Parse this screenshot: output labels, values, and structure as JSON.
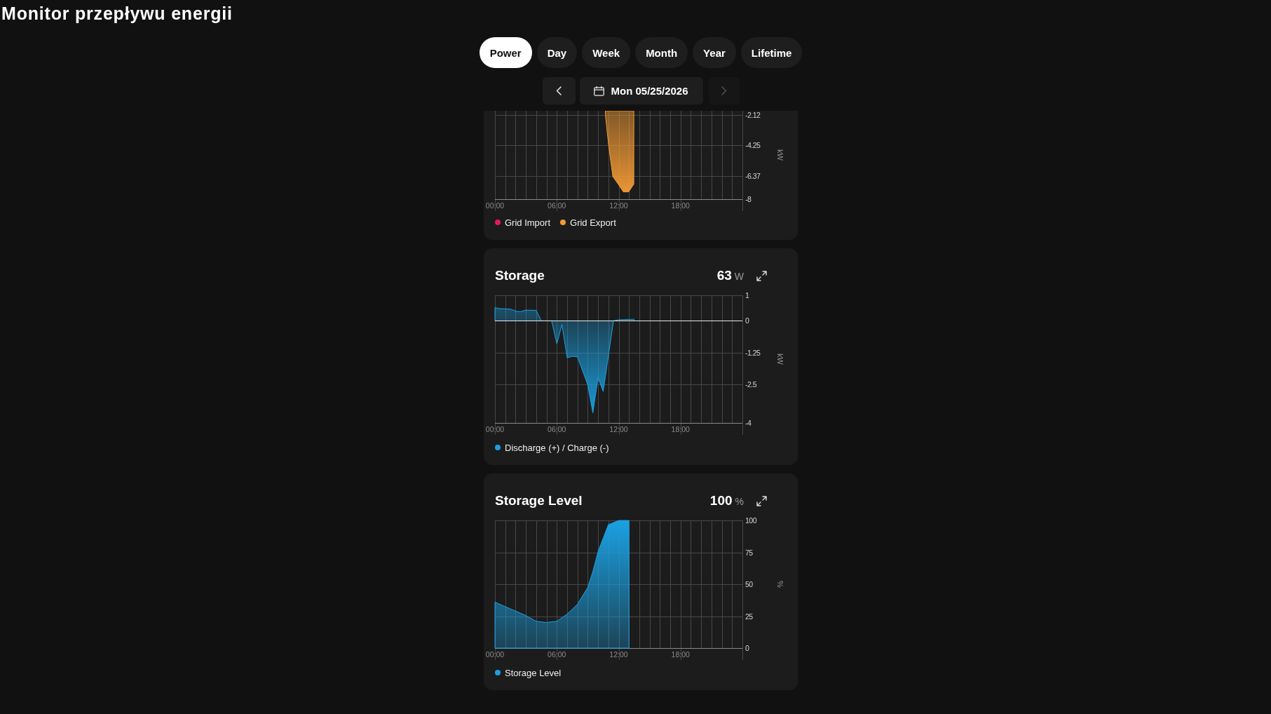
{
  "title": "Monitor przepływu energii",
  "tabs": [
    {
      "label": "Power",
      "selected": true
    },
    {
      "label": "Day",
      "selected": false
    },
    {
      "label": "Week",
      "selected": false
    },
    {
      "label": "Month",
      "selected": false
    },
    {
      "label": "Year",
      "selected": false
    },
    {
      "label": "Lifetime",
      "selected": false
    }
  ],
  "date_nav": {
    "date": "Mon 05/25/2026",
    "prev_disabled": false,
    "next_disabled": true
  },
  "cards": [
    {
      "chart_data": {
        "type": "area",
        "grid": true,
        "ylabel": "kW",
        "xlim": [
          0,
          24
        ],
        "ylim": [
          -8,
          -1.85
        ],
        "xticks": [
          {
            "value": 0,
            "label": "00:00"
          },
          {
            "value": 6,
            "label": "06:00"
          },
          {
            "value": 12,
            "label": "12:00"
          },
          {
            "value": 18,
            "label": "18:00"
          }
        ],
        "yticks": [
          -2.12,
          -4.25,
          -6.37,
          -8
        ],
        "x": [
          10.71,
          11.04,
          11.43,
          11.95,
          12.45,
          12.97,
          13.47
        ],
        "series": [
          {
            "name": "Grid Import",
            "color": "#e8175d",
            "values": [
              null,
              null,
              null,
              null,
              null,
              null,
              null
            ]
          },
          {
            "name": "Grid Export",
            "color": "#f29a35",
            "values": [
              -2.12,
              -4.34,
              -6.42,
              -6.95,
              -7.49,
              -7.49,
              -6.95
            ]
          }
        ]
      }
    },
    {
      "title": "Storage",
      "value": "63",
      "unit": "W",
      "chart_data": {
        "type": "area",
        "grid": true,
        "ylabel": "kW",
        "xlim": [
          0,
          24
        ],
        "ylim": [
          -4,
          1
        ],
        "xticks": [
          {
            "value": 0,
            "label": "00:00"
          },
          {
            "value": 6,
            "label": "06:00"
          },
          {
            "value": 12,
            "label": "12:00"
          },
          {
            "value": 18,
            "label": "18:00"
          }
        ],
        "yticks": [
          1,
          0,
          -1.25,
          -2.5,
          -4
        ],
        "x": [
          0,
          0.4,
          1.5,
          2.1,
          2.5,
          3,
          4,
          4.5,
          5.5,
          6,
          6.5,
          7,
          7.5,
          8,
          9,
          9.5,
          10,
          10.5,
          11.5,
          12,
          13.5
        ],
        "series": [
          {
            "name": "Discharge (+) / Charge (-)",
            "color": "#1ba1e2",
            "values": [
              0.52,
              0.48,
              0.46,
              0.37,
              0.36,
              0.42,
              0.41,
              0,
              0,
              -0.9,
              -0.14,
              -1.45,
              -1.39,
              -1.41,
              -2.51,
              -3.61,
              -2.23,
              -2.77,
              0,
              0.04,
              0.06
            ]
          }
        ]
      }
    },
    {
      "title": "Storage Level",
      "value": "100",
      "unit": "%",
      "chart_data": {
        "type": "area",
        "grid": true,
        "ylabel": "%",
        "xlim": [
          0,
          24
        ],
        "ylim": [
          0,
          100
        ],
        "xticks": [
          {
            "value": 0,
            "label": "00:00"
          },
          {
            "value": 6,
            "label": "06:00"
          },
          {
            "value": 12,
            "label": "12:00"
          },
          {
            "value": 18,
            "label": "18:00"
          }
        ],
        "yticks": [
          100,
          75,
          50,
          25,
          0
        ],
        "x": [
          0,
          1,
          2,
          3,
          4,
          5,
          6,
          7,
          8,
          9,
          9.5,
          10,
          11,
          12,
          13
        ],
        "series": [
          {
            "name": "Storage Level",
            "color": "#1ba1e2",
            "values": [
              36,
              32.5,
              29,
              25.5,
              21,
              20,
              21,
              26.6,
              34.3,
              47.5,
              60,
              75.6,
              96.7,
              100,
              100
            ]
          }
        ]
      }
    }
  ]
}
